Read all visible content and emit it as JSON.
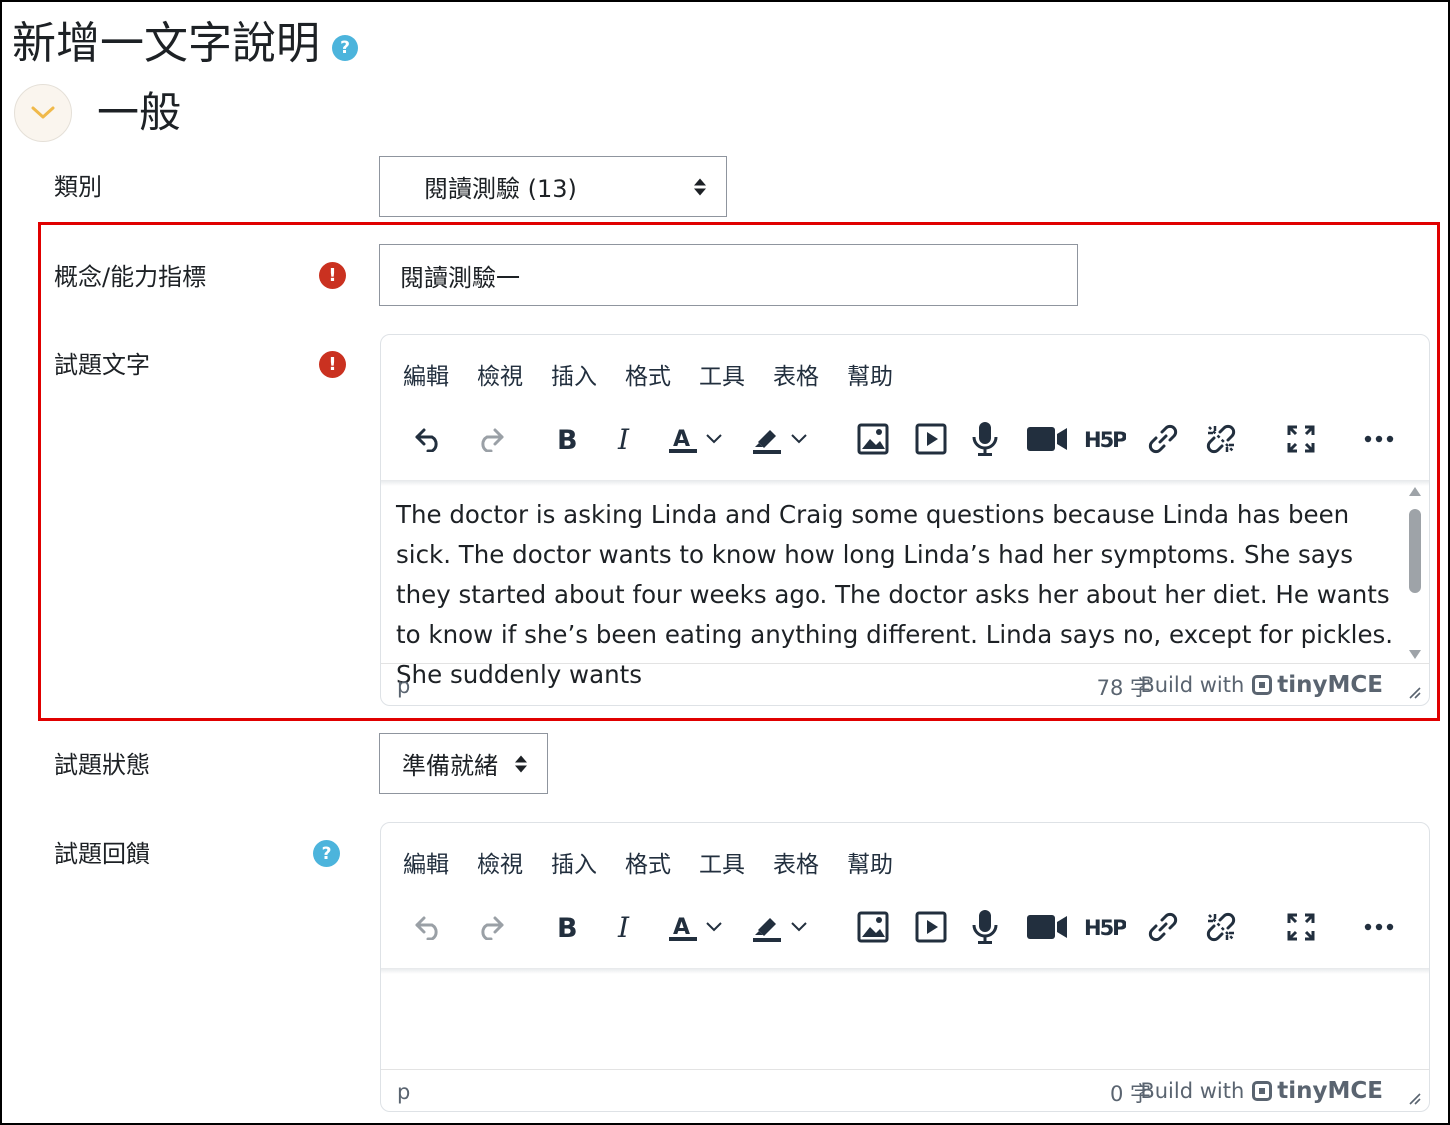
{
  "page": {
    "title": "新增一文字說明",
    "section_title": "一般"
  },
  "fields": {
    "category_label": "類別",
    "category_value": "閱讀測驗 (13)",
    "concept_label": "概念/能力指標",
    "concept_value": "閱讀測驗一",
    "question_text_label": "試題文字",
    "status_label": "試題狀態",
    "status_value": "準備就緒",
    "feedback_label": "試題回饋"
  },
  "editor_menu": [
    "編輯",
    "檢視",
    "插入",
    "格式",
    "工具",
    "表格",
    "幫助"
  ],
  "editor1": {
    "content": "The doctor is asking Linda and Craig some questions because Linda has been sick. The doctor wants to know how long Linda’s had her symptoms. She says they started about four weeks ago. The doctor asks her about her diet. He wants to know if she’s been eating anything different. Linda says no, except for pickles. She suddenly wants",
    "path": "p",
    "word_count": "78 字",
    "build_with": "Build with",
    "brand": "tinyMCE"
  },
  "editor2": {
    "content": "",
    "path": "p",
    "word_count": "0 字",
    "build_with": "Build with",
    "brand": "tinyMCE"
  },
  "colors": {
    "error": "#ca3120",
    "help": "#4cb4dc",
    "highlight_box": "#e00000"
  }
}
